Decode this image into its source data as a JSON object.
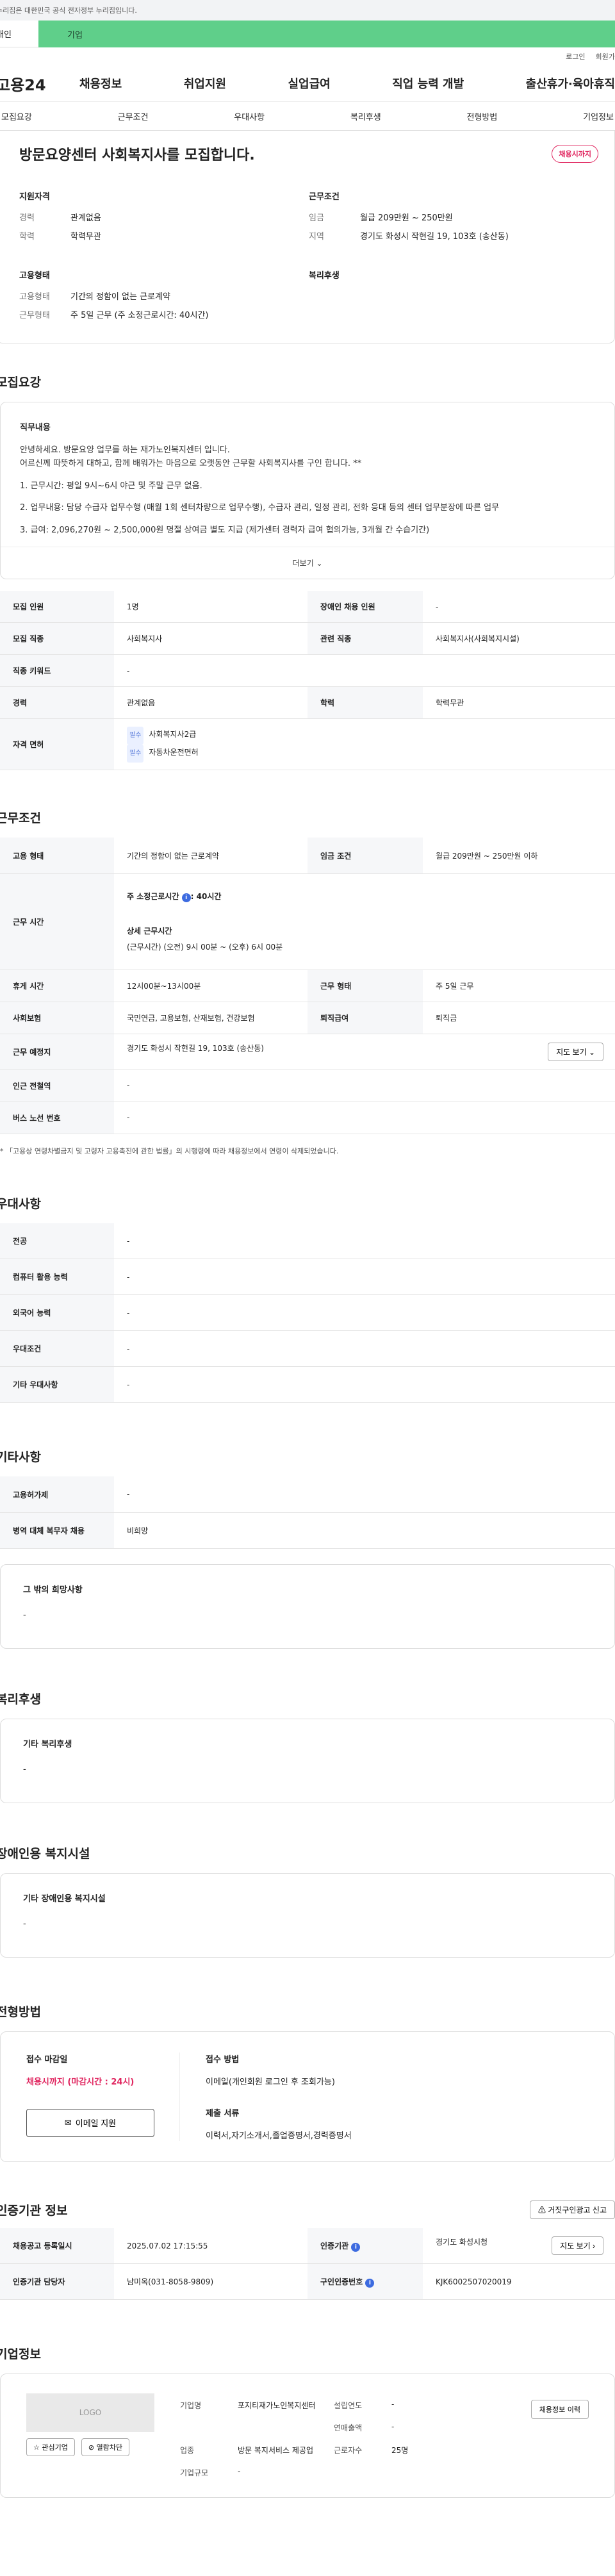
{
  "topbar": {
    "text": "누리집은 대한민국 공식 전자정부 누리집입니다."
  },
  "tabs": {
    "person": "개인",
    "biz": "기업"
  },
  "util": {
    "login": "로그인",
    "join": "회원가입"
  },
  "gnb": {
    "logo": "고용24",
    "menu": [
      "채용정보",
      "취업지원",
      "실업급여",
      "직업 능력 개발",
      "출산휴가·육아휴직"
    ]
  },
  "subnav": [
    "모집요강",
    "근무조건",
    "우대사항",
    "복리후생",
    "전형방법",
    "기업정보"
  ],
  "summary": {
    "title": "방문요양센터 사회복지사를 모집합니다.",
    "badge": "채용시까지",
    "qual": {
      "heading": "지원자격",
      "rows": [
        [
          "경력",
          "관계없음"
        ],
        [
          "학력",
          "학력무관"
        ]
      ]
    },
    "cond": {
      "heading": "근무조건",
      "rows": [
        [
          "임금",
          "월급 209만원 ~ 250만원"
        ],
        [
          "지역",
          "경기도 화성시 작현길 19, 103호 (송산동)"
        ]
      ]
    },
    "emp": {
      "heading": "고용형태",
      "rows": [
        [
          "고용형태",
          "기간의 정함이 없는 근로계약"
        ],
        [
          "근무형태",
          "주 5일 근무 (주 소정근로시간: 40시간)"
        ]
      ]
    },
    "welfare": {
      "heading": "복리후생"
    }
  },
  "recruit": {
    "title": "모집요강",
    "duty_heading": "직무내용",
    "duty_lines": [
      "안녕하세요. 방문요양 업무를 하는 재가노인복지센터 입니다.",
      "어르신께 따뜻하게 대하고, 함께 배워가는 마음으로 오랫동안 근무할 사회복지사를 구인 합니다. **",
      "1. 근무시간: 평일  9시~6시 야근 및 주말 근무 없음.",
      "2. 업무내용: 담당 수급자 업무수행 (매월 1회 센터차량으로 업무수행), 수급자 관리, 일정 관리, 전화 응대 등의 센터 업무분장에 따른 업무",
      "3. 급여: 2,096,270원 ~ 2,500,000원 명절 상여금 별도 지급 (제가센터 경력자 급여 협의가능, 3개월 간 수습기간)"
    ],
    "more": "더보기",
    "rows": [
      {
        "k1": "모집 인원",
        "v1": "1명",
        "k2": "장애인 채용 인원",
        "v2": "-"
      },
      {
        "k1": "모집 직종",
        "v1": "사회복지사",
        "k2": "관련 직종",
        "v2": "사회복지사(사회복지시설)"
      },
      {
        "k1": "직종 키워드",
        "v1": "-"
      },
      {
        "k1": "경력",
        "v1": "관계없음",
        "k2": "학력",
        "v2": "학력무관"
      }
    ],
    "license_label": "자격 면허",
    "licenses": [
      {
        "tag": "필수",
        "name": "사회복지사2급"
      },
      {
        "tag": "필수",
        "name": "자동차운전면허"
      }
    ]
  },
  "work": {
    "title": "근무조건",
    "emp_type_k": "고용 형태",
    "emp_type_v": "기간의 정함이 없는 근로계약",
    "wage_k": "임금 조건",
    "wage_v": "월급 209만원 ~ 250만원 이하",
    "hours_k": "근무 시간",
    "hours_weekly": "주 소정근로시간",
    "hours_weekly_v": ": 40시간",
    "hours_detail_h": "상세 근무시간",
    "hours_detail": "(근무시간) (오전) 9시 00분 ~ (오후) 6시 00분",
    "break_k": "휴게 시간",
    "break_v": "12시00분~13시00분",
    "form_k": "근무 형태",
    "form_v": "주 5일 근무",
    "ins_k": "사회보험",
    "ins_v": "국민연금, 고용보험, 산재보험, 건강보험",
    "ret_k": "퇴직급여",
    "ret_v": "퇴직금",
    "place_k": "근무 예정지",
    "place_v": "경기도 화성시 작현길 19, 103호 (송산동)",
    "map_btn": "지도 보기",
    "subway_k": "인근 전철역",
    "subway_v": "-",
    "bus_k": "버스 노선 번호",
    "bus_v": "-",
    "note": "* 「고용상 연령차별금지 및 고령자 고용촉진에 관한 법률」의 시행령에 따라 채용정보에서 연령이 삭제되었습니다."
  },
  "pref": {
    "title": "우대사항",
    "rows": [
      [
        "전공",
        "-"
      ],
      [
        "컴퓨터 활용 능력",
        "-"
      ],
      [
        "외국어 능력",
        "-"
      ],
      [
        "우대조건",
        "-"
      ],
      [
        "기타 우대사항",
        "-"
      ]
    ]
  },
  "etc": {
    "title": "기타사항",
    "rows": [
      [
        "고용허가제",
        "-"
      ],
      [
        "병역 대체 복무자 채용",
        "비희망"
      ]
    ],
    "wish_h": "그 밖의 희망사항",
    "wish_v": "-"
  },
  "welfare": {
    "title": "복리후생",
    "h": "기타 복리후생",
    "v": "-"
  },
  "disabled": {
    "title": "장애인용 복지시설",
    "h": "기타 장애인용 복지시설",
    "v": "-"
  },
  "process": {
    "title": "전형방법",
    "deadline_h": "접수 마감일",
    "deadline_v": "채용시까지 (마감시간 : 24시)",
    "email_btn": "이메일 지원",
    "method_h": "접수 방법",
    "method_v": "이메일(개인회원 로그인 후 조회가능)",
    "docs_h": "제출 서류",
    "docs_v": "이력서,자기소개서,졸업증명서,경력증명서"
  },
  "cert": {
    "title": "인증기관 정보",
    "report_btn": "거짓구인광고 신고",
    "reg_k": "채용공고 등록일시",
    "reg_v": "2025.07.02 17:15:55",
    "org_k": "인증기관",
    "org_v": "경기도 화성시청",
    "map_btn": "지도 보기",
    "mgr_k": "인증기관 담당자",
    "mgr_v": "남미옥(031-8058-9809)",
    "num_k": "구인인증번호",
    "num_v": "KJK6002507020019"
  },
  "company": {
    "title": "기업정보",
    "logo": "LOGO",
    "fav_btn": "관심기업",
    "block_btn": "열람차단",
    "history_btn": "채용정보 이력",
    "rows": [
      [
        "기업명",
        "포지티재가노인복지센터",
        "설립연도",
        "-"
      ],
      [
        "",
        "",
        "연매출액",
        "-"
      ],
      [
        "업종",
        "방문 복지서비스 제공업",
        "근로자수",
        "25명"
      ],
      [
        "기업규모",
        "-",
        "",
        ""
      ]
    ]
  }
}
